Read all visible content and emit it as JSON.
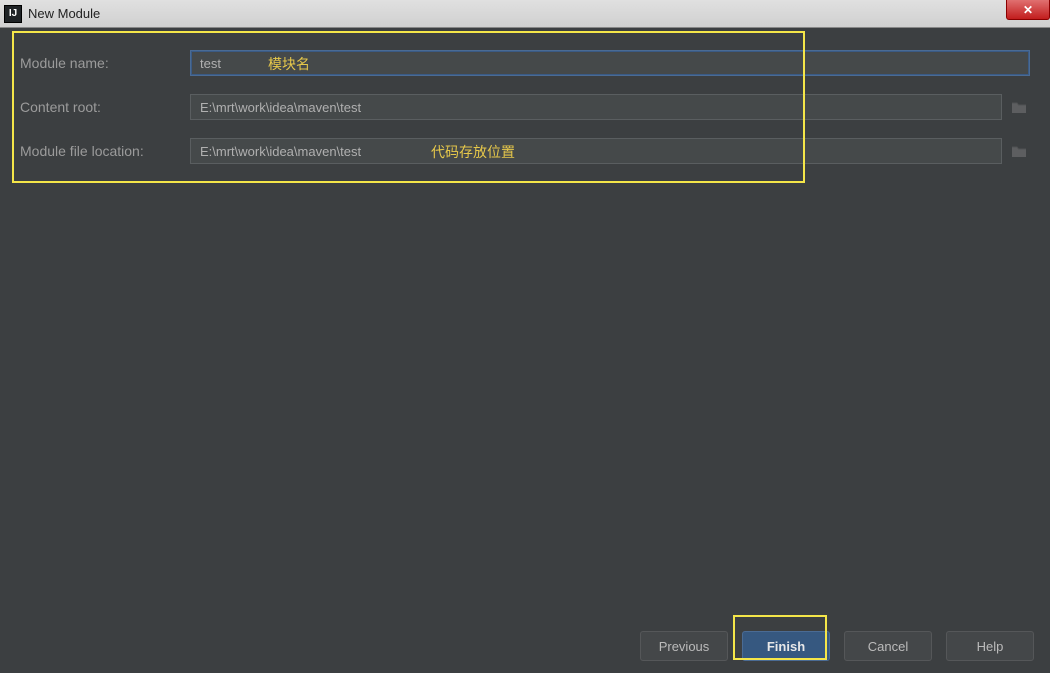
{
  "window": {
    "title": "New Module",
    "app_icon_text": "IJ"
  },
  "form": {
    "module_name": {
      "label": "Module name:",
      "value": "test",
      "overlay": "模块名"
    },
    "content_root": {
      "label": "Content root:",
      "value": "E:\\mrt\\work\\idea\\maven\\test"
    },
    "module_file_location": {
      "label": "Module file location:",
      "value": "E:\\mrt\\work\\idea\\maven\\test",
      "overlay": "代码存放位置"
    }
  },
  "buttons": {
    "previous": "Previous",
    "finish": "Finish",
    "cancel": "Cancel",
    "help": "Help"
  },
  "colors": {
    "highlight": "#f5e649",
    "primary_button": "#365880",
    "bg": "#3c3f41"
  }
}
